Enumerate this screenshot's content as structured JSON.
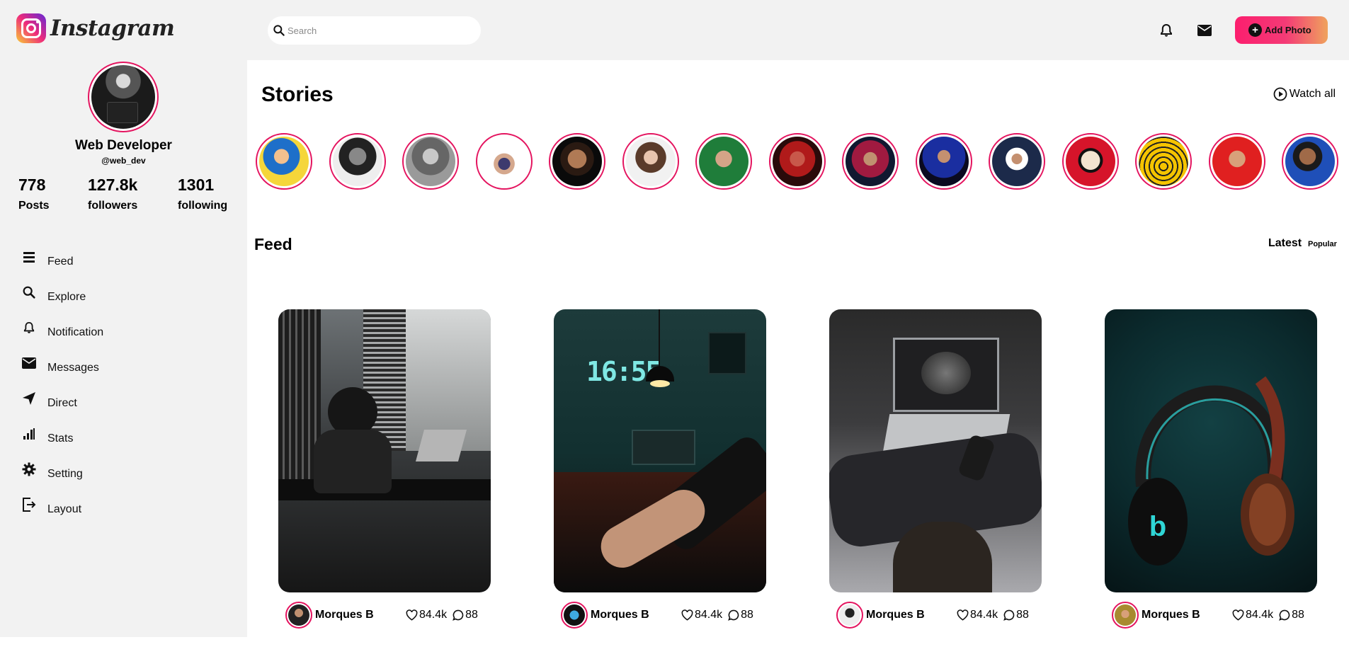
{
  "brand": {
    "name": "Instagram"
  },
  "search": {
    "placeholder": "Search",
    "value": ""
  },
  "header": {
    "add_photo_label": "Add Photo"
  },
  "profile": {
    "name": "Web Developer",
    "handle": "@web_dev",
    "stats": [
      {
        "value": "778",
        "label": "Posts"
      },
      {
        "value": "127.8k",
        "label": "followers"
      },
      {
        "value": "1301",
        "label": "following"
      }
    ]
  },
  "sidebar": {
    "items": [
      {
        "label": "Feed",
        "icon": "menu-icon"
      },
      {
        "label": "Explore",
        "icon": "search-icon"
      },
      {
        "label": "Notification",
        "icon": "bell-icon"
      },
      {
        "label": "Messages",
        "icon": "envelope-icon"
      },
      {
        "label": "Direct",
        "icon": "send-icon"
      },
      {
        "label": "Stats",
        "icon": "stats-icon"
      },
      {
        "label": "Setting",
        "icon": "gear-icon"
      },
      {
        "label": "Layout",
        "icon": "exit-icon"
      }
    ]
  },
  "stories": {
    "title": "Stories",
    "watch_all_label": "Watch all",
    "count": 15
  },
  "feed": {
    "title": "Feed",
    "tabs": {
      "latest": "Latest",
      "popular": "Popular"
    },
    "posts": [
      {
        "author": "Morques B",
        "likes": "84.4k",
        "comments": "88"
      },
      {
        "author": "Morques B",
        "likes": "84.4k",
        "comments": "88"
      },
      {
        "author": "Morques B",
        "likes": "84.4k",
        "comments": "88"
      },
      {
        "author": "Morques B",
        "likes": "84.4k",
        "comments": "88"
      }
    ]
  },
  "colors": {
    "accent": "#e4145f",
    "sidebar_bg": "#f2f2f2",
    "button_gradient_start": "#fc1e6e",
    "button_gradient_end": "#efa35d"
  }
}
